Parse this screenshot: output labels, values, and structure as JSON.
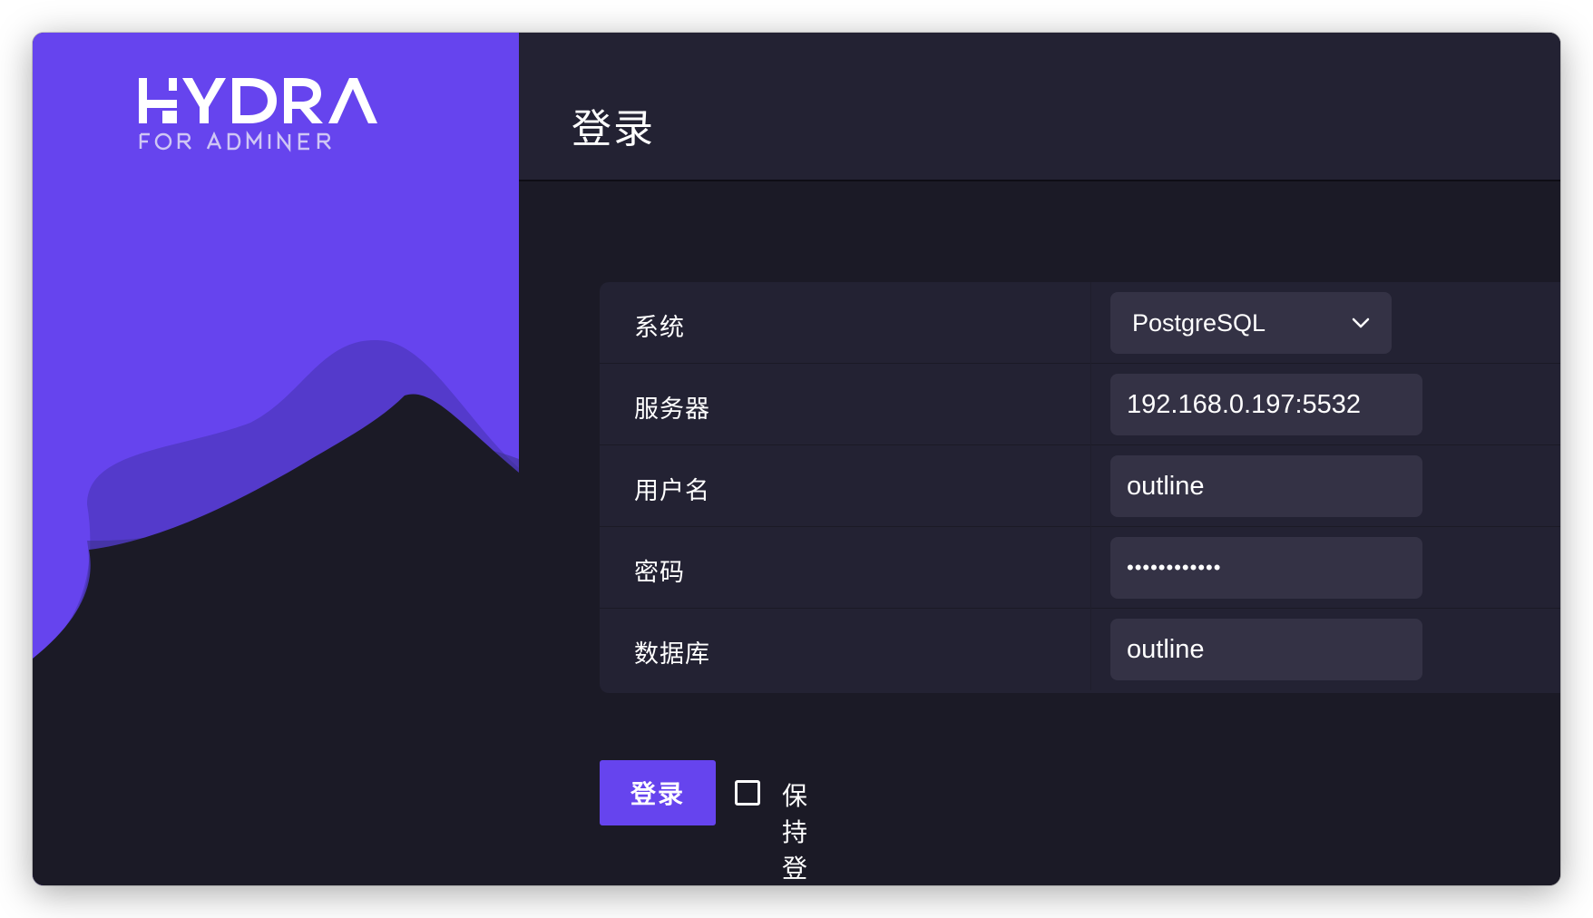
{
  "brand": {
    "logo_title": "HYDRA",
    "logo_subtitle": "FOR ADMINER"
  },
  "header": {
    "title": "登录"
  },
  "form": {
    "rows": [
      {
        "label": "系统",
        "value": "PostgreSQL",
        "type": "select"
      },
      {
        "label": "服务器",
        "value": "192.168.0.197:5532",
        "type": "text"
      },
      {
        "label": "用户名",
        "value": "outline",
        "type": "text"
      },
      {
        "label": "密码",
        "value": "••••••••••••",
        "type": "password"
      },
      {
        "label": "数据库",
        "value": "outline",
        "type": "text"
      }
    ]
  },
  "actions": {
    "login_label": "登录",
    "remember_label": "保持登录",
    "remember_checked": false
  },
  "colors": {
    "accent": "#6644ee",
    "background": "#1b1a26",
    "panel": "#232233",
    "field": "#343245",
    "text": "#ffffff"
  }
}
